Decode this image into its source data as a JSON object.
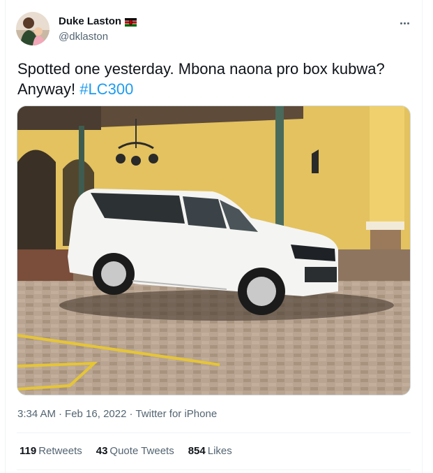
{
  "author": {
    "display_name": "Duke Laston",
    "handle": "@dklaston",
    "flag_icon": "kenya-flag-icon"
  },
  "tweet": {
    "text": "Spotted one yesterday. Mbona naona pro box kubwa? Anyway! ",
    "hashtag": "#LC300"
  },
  "meta": {
    "time": "3:34 AM",
    "sep1": "·",
    "date": "Feb 16, 2022",
    "sep2": "·",
    "source": "Twitter for iPhone"
  },
  "stats": {
    "retweets_count": "119",
    "retweets_label": "Retweets",
    "quotes_count": "43",
    "quotes_label": "Quote Tweets",
    "likes_count": "854",
    "likes_label": "Likes"
  },
  "colors": {
    "link": "#1d9bf0",
    "secondary_text": "#536471",
    "primary_text": "#0f1419"
  }
}
